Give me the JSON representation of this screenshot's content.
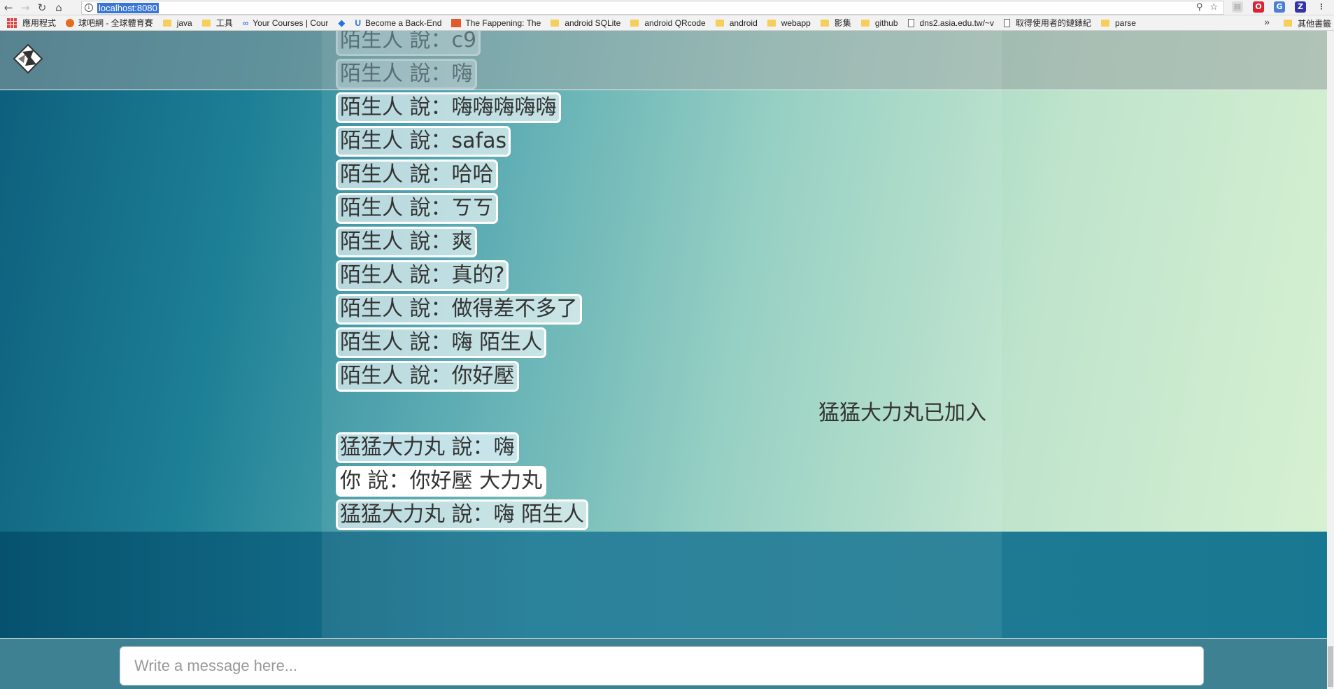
{
  "browser": {
    "url": "localhost:8080",
    "bookmarks": [
      {
        "label": "應用程式",
        "kind": "apps"
      },
      {
        "label": "球吧網 - 全球體育賽",
        "kind": "site"
      },
      {
        "label": "java",
        "kind": "folder"
      },
      {
        "label": "工具",
        "kind": "folder"
      },
      {
        "label": "Your Courses | Cour",
        "kind": "site"
      },
      {
        "label": "",
        "kind": "dropbox"
      },
      {
        "label": "Become a Back-End",
        "kind": "site"
      },
      {
        "label": "The Fappening: The",
        "kind": "site"
      },
      {
        "label": "android SQLite",
        "kind": "folder"
      },
      {
        "label": "android QRcode",
        "kind": "folder"
      },
      {
        "label": "android",
        "kind": "folder"
      },
      {
        "label": "webapp",
        "kind": "folder"
      },
      {
        "label": "影集",
        "kind": "folder"
      },
      {
        "label": "github",
        "kind": "folder"
      },
      {
        "label": "dns2.asia.edu.tw/~v",
        "kind": "page"
      },
      {
        "label": "取得使用者的鏈錶紀",
        "kind": "page"
      },
      {
        "label": "parse",
        "kind": "folder"
      }
    ],
    "more": "»",
    "other_bookmarks": "其他書籤"
  },
  "chat": {
    "messages": [
      {
        "text": "陌生人 說：c9",
        "style": "faded"
      },
      {
        "text": "陌生人 說：嗨",
        "style": "faded"
      },
      {
        "text": "陌生人 說：嗨嗨嗨嗨嗨",
        "style": "normal"
      },
      {
        "text": "陌生人 說：safas",
        "style": "normal"
      },
      {
        "text": "陌生人 說：哈哈",
        "style": "normal"
      },
      {
        "text": "陌生人 說：ㄎㄎ",
        "style": "normal"
      },
      {
        "text": "陌生人 說：爽",
        "style": "normal"
      },
      {
        "text": "陌生人 說：真的?",
        "style": "normal"
      },
      {
        "text": "陌生人 說：做得差不多了",
        "style": "normal"
      },
      {
        "text": "陌生人 說：嗨 陌生人",
        "style": "normal"
      },
      {
        "text": "陌生人 說：你好壓",
        "style": "normal"
      }
    ],
    "join_notice": "猛猛大力丸已加入",
    "later_messages": [
      {
        "text": "猛猛大力丸 說：嗨",
        "style": "normal"
      },
      {
        "text": "你 說：你好壓 大力丸",
        "style": "mine"
      },
      {
        "text": "猛猛大力丸 說：嗨 陌生人",
        "style": "normal"
      }
    ]
  },
  "compose": {
    "placeholder": "Write a message here..."
  },
  "colors": {
    "accent_url": "#3875d7",
    "bubble_border": "#ffffff",
    "compose_bg": "#3e8193"
  }
}
